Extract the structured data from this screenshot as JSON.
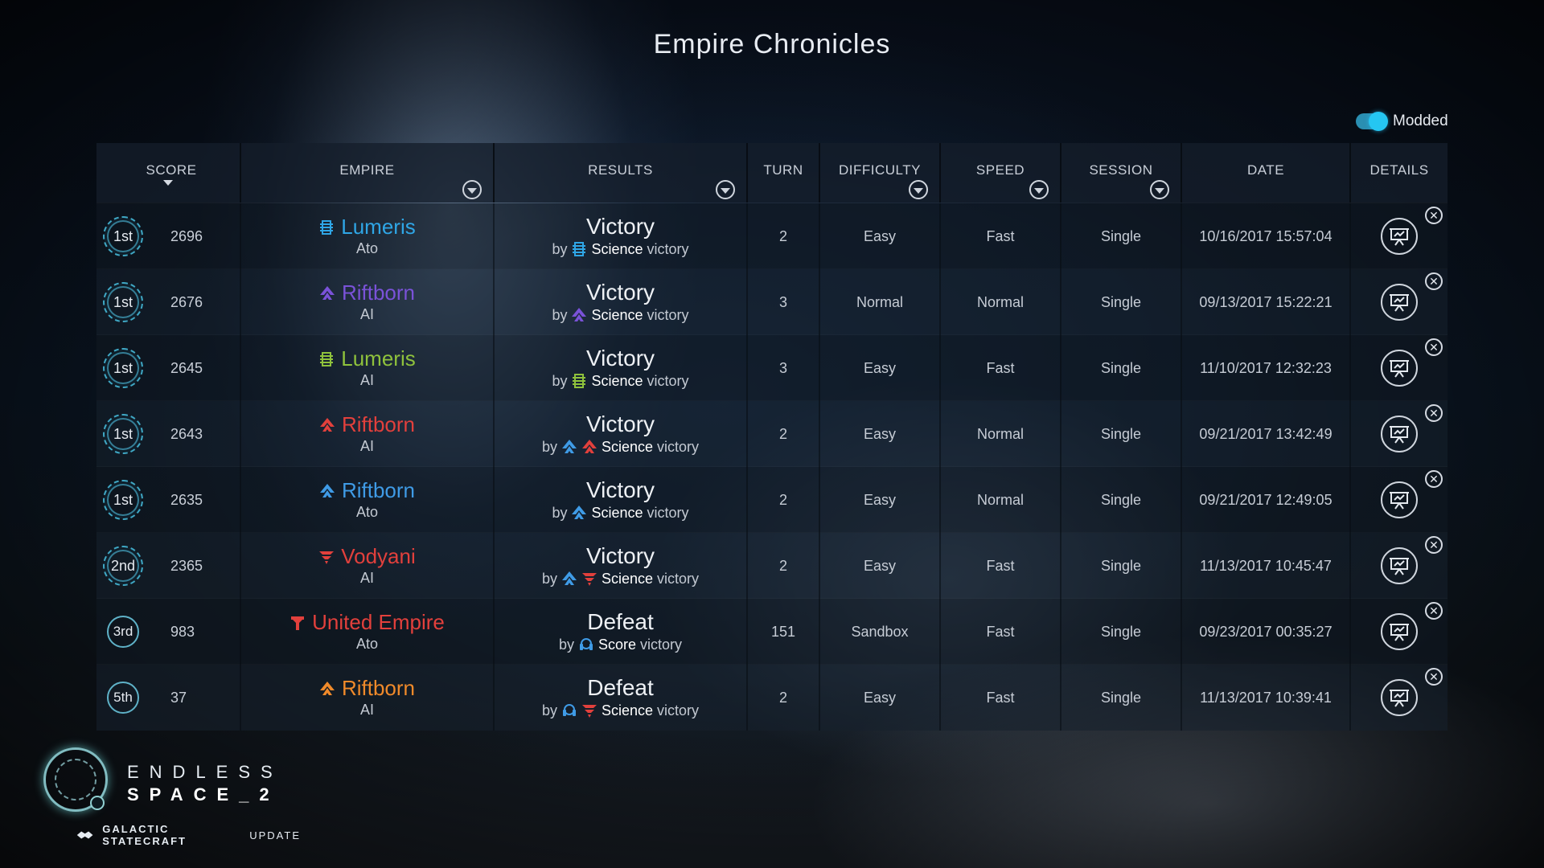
{
  "title": "Empire Chronicles",
  "modded": {
    "label": "Modded",
    "enabled": true
  },
  "headers": {
    "score": "SCORE",
    "empire": "EMPIRE",
    "results": "RESULTS",
    "turn": "TURN",
    "difficulty": "DIFFICULTY",
    "speed": "SPEED",
    "session": "SESSION",
    "date": "DATE",
    "details": "DETAILS"
  },
  "rows": [
    {
      "rank": "1st",
      "score": "2696",
      "empire": "Lumeris",
      "empire_color": "#2fa6e6",
      "empire_icon": "lumeris-icon",
      "player": "Ato",
      "result": "Victory",
      "by": "by",
      "victory_kind": "Science",
      "victory_word": "victory",
      "by_icons": [
        {
          "icon": "lumeris-icon",
          "color": "#2fa6e6"
        }
      ],
      "turn": "2",
      "difficulty": "Easy",
      "speed": "Fast",
      "session": "Single",
      "date": "10/16/2017 15:57:04"
    },
    {
      "rank": "1st",
      "score": "2676",
      "empire": "Riftborn",
      "empire_color": "#7a52d8",
      "empire_icon": "riftborn-icon",
      "player": "AI",
      "result": "Victory",
      "by": "by",
      "victory_kind": "Science",
      "victory_word": "victory",
      "by_icons": [
        {
          "icon": "riftborn-icon",
          "color": "#7a52d8"
        }
      ],
      "turn": "3",
      "difficulty": "Normal",
      "speed": "Normal",
      "session": "Single",
      "date": "09/13/2017 15:22:21"
    },
    {
      "rank": "1st",
      "score": "2645",
      "empire": "Lumeris",
      "empire_color": "#8fc23c",
      "empire_icon": "lumeris-icon",
      "player": "AI",
      "result": "Victory",
      "by": "by",
      "victory_kind": "Science",
      "victory_word": "victory",
      "by_icons": [
        {
          "icon": "lumeris-icon",
          "color": "#8fc23c"
        }
      ],
      "turn": "3",
      "difficulty": "Easy",
      "speed": "Fast",
      "session": "Single",
      "date": "11/10/2017 12:32:23"
    },
    {
      "rank": "1st",
      "score": "2643",
      "empire": "Riftborn",
      "empire_color": "#e2403c",
      "empire_icon": "riftborn-icon",
      "player": "AI",
      "result": "Victory",
      "by": "by",
      "victory_kind": "Science",
      "victory_word": "victory",
      "by_icons": [
        {
          "icon": "riftborn-icon",
          "color": "#3f9be6"
        },
        {
          "icon": "riftborn-icon",
          "color": "#e2403c"
        }
      ],
      "turn": "2",
      "difficulty": "Easy",
      "speed": "Normal",
      "session": "Single",
      "date": "09/21/2017 13:42:49"
    },
    {
      "rank": "1st",
      "score": "2635",
      "empire": "Riftborn",
      "empire_color": "#3f9be6",
      "empire_icon": "riftborn-icon",
      "player": "Ato",
      "result": "Victory",
      "by": "by",
      "victory_kind": "Science",
      "victory_word": "victory",
      "by_icons": [
        {
          "icon": "riftborn-icon",
          "color": "#3f9be6"
        }
      ],
      "turn": "2",
      "difficulty": "Easy",
      "speed": "Normal",
      "session": "Single",
      "date": "09/21/2017 12:49:05"
    },
    {
      "rank": "2nd",
      "score": "2365",
      "empire": "Vodyani",
      "empire_color": "#e2403c",
      "empire_icon": "vodyani-icon",
      "player": "AI",
      "result": "Victory",
      "by": "by",
      "victory_kind": "Science",
      "victory_word": "victory",
      "by_icons": [
        {
          "icon": "riftborn-icon",
          "color": "#3f9be6"
        },
        {
          "icon": "vodyani-icon",
          "color": "#e2403c"
        }
      ],
      "turn": "2",
      "difficulty": "Easy",
      "speed": "Fast",
      "session": "Single",
      "date": "11/13/2017 10:45:47"
    },
    {
      "rank": "3rd",
      "score": "983",
      "empire": "United Empire",
      "empire_color": "#e2403c",
      "empire_icon": "united-empire-icon",
      "player": "Ato",
      "result": "Defeat",
      "by": "by",
      "victory_kind": "Score",
      "victory_word": "victory",
      "by_icons": [
        {
          "icon": "players-icon",
          "color": "#3f9be6"
        }
      ],
      "turn": "151",
      "difficulty": "Sandbox",
      "speed": "Fast",
      "session": "Single",
      "date": "09/23/2017 00:35:27"
    },
    {
      "rank": "5th",
      "score": "37",
      "empire": "Riftborn",
      "empire_color": "#f08a2a",
      "empire_icon": "riftborn-icon",
      "player": "AI",
      "result": "Defeat",
      "by": "by",
      "victory_kind": "Science",
      "victory_word": "victory",
      "by_icons": [
        {
          "icon": "players-icon",
          "color": "#3f9be6"
        },
        {
          "icon": "vodyani-icon",
          "color": "#e2403c"
        }
      ],
      "turn": "2",
      "difficulty": "Easy",
      "speed": "Fast",
      "session": "Single",
      "date": "11/13/2017 10:39:41"
    }
  ],
  "logo": {
    "line1": "ENDLESS",
    "line2": "SPACE_2",
    "subtitle_bold": "GALACTIC STATECRAFT",
    "subtitle_normal": "UPDATE"
  }
}
